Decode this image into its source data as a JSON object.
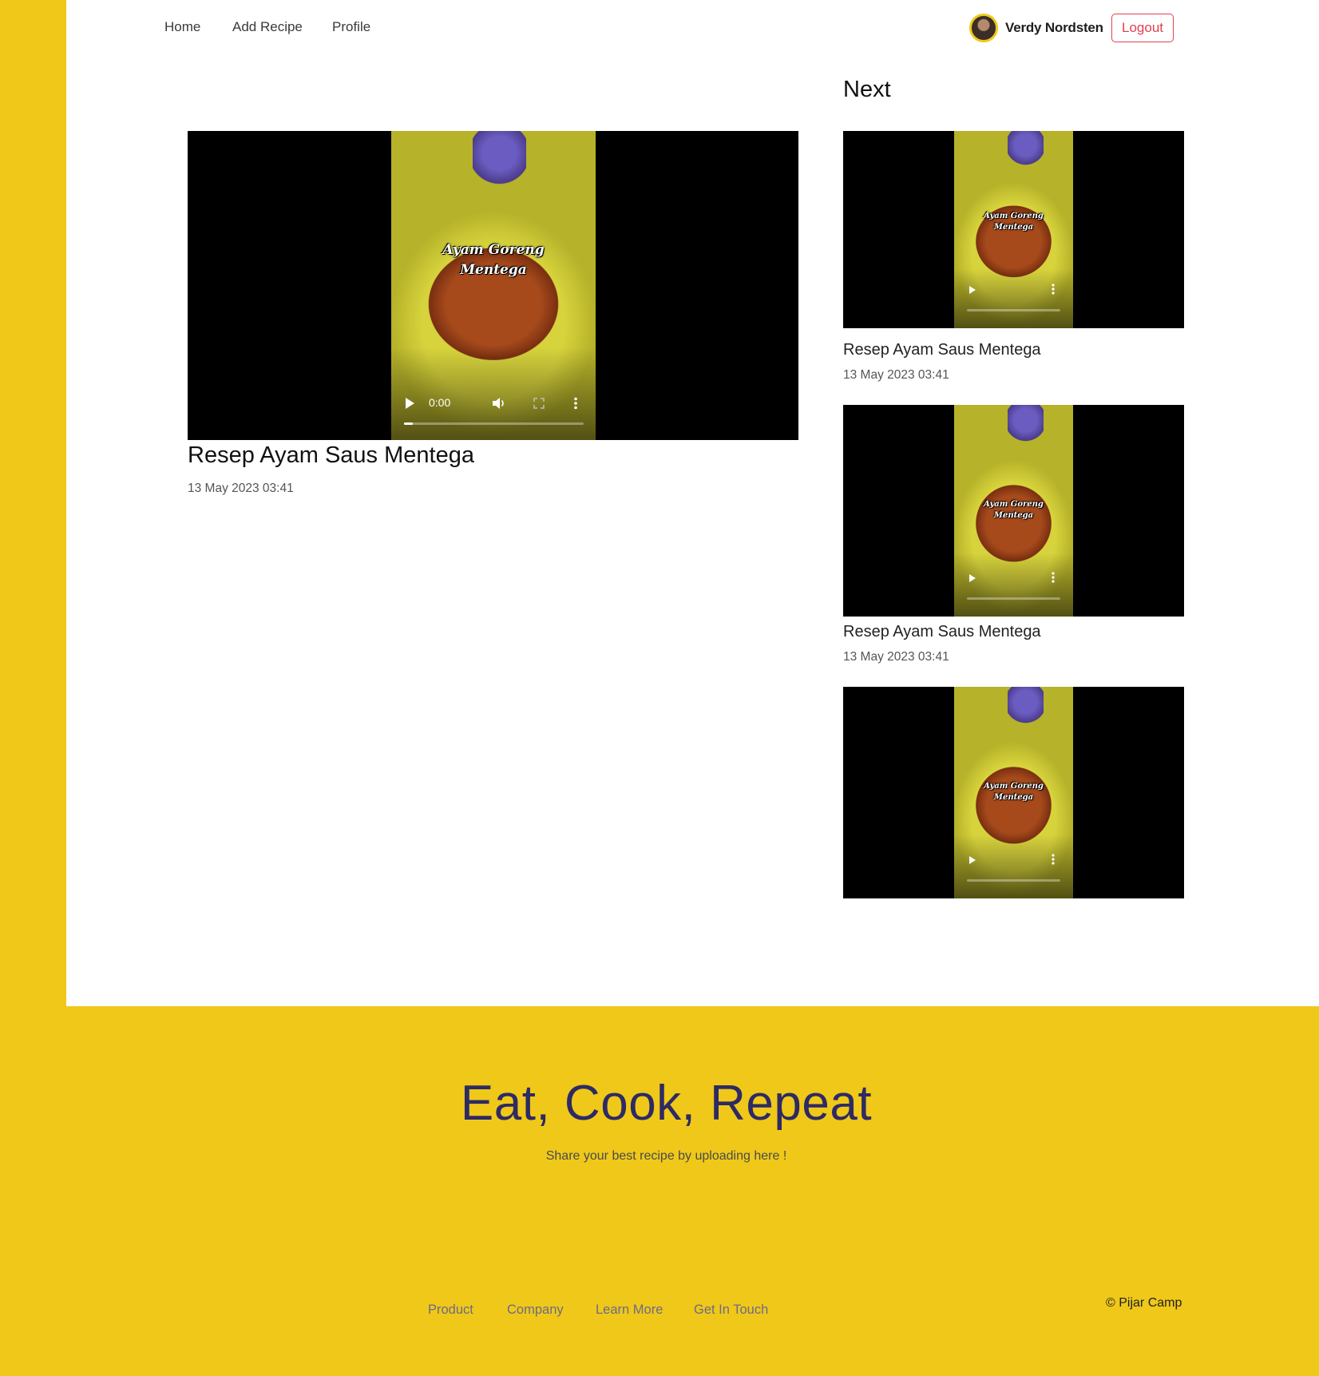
{
  "nav": {
    "links": [
      "Home",
      "Add Recipe",
      "Profile"
    ],
    "user_name": "Verdy Nordsten",
    "logout_label": "Logout"
  },
  "main": {
    "video": {
      "caption_line1": "Ayam Goreng",
      "caption_line2": "Mentega",
      "time": "0:00",
      "progress": 0.05
    },
    "title": "Resep Ayam Saus Mentega",
    "date": "13 May 2023 03:41"
  },
  "next": {
    "heading": "Next",
    "items": [
      {
        "caption_line1": "Ayam Goreng",
        "caption_line2": "Mentega",
        "title": "Resep Ayam Saus Mentega",
        "date": "13 May 2023 03:41"
      },
      {
        "caption_line1": "Ayam Goreng",
        "caption_line2": "Mentega",
        "title": "Resep Ayam Saus Mentega",
        "date": "13 May 2023 03:41"
      },
      {
        "caption_line1": "Ayam Goreng",
        "caption_line2": "Mentega"
      }
    ]
  },
  "footer": {
    "title": "Eat, Cook, Repeat",
    "subtitle": "Share your best recipe by uploading here !",
    "links": [
      "Product",
      "Company",
      "Learn More",
      "Get In Touch"
    ],
    "copyright": "© Pijar Camp"
  },
  "colors": {
    "brand_yellow": "#efc81a",
    "footer_title": "#2e2a63",
    "logout_red": "#e0414f"
  },
  "icons": [
    "play-icon",
    "volume-icon",
    "fullscreen-icon",
    "more-options-icon"
  ]
}
